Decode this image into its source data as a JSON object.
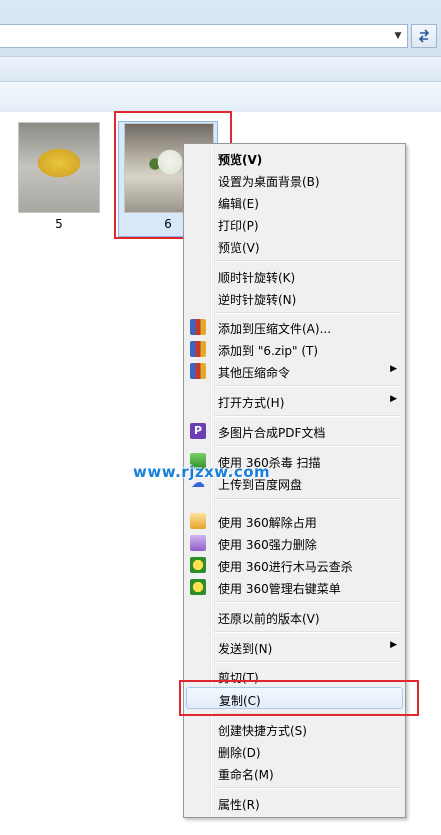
{
  "thumbnails": [
    {
      "name": "5"
    },
    {
      "name": "6"
    }
  ],
  "context_menu": {
    "items": [
      {
        "label": "预览(V)",
        "bold": true
      },
      {
        "label": "设置为桌面背景(B)"
      },
      {
        "label": "编辑(E)"
      },
      {
        "label": "打印(P)"
      },
      {
        "label": "预览(V)"
      },
      {
        "label": "顺时针旋转(K)"
      },
      {
        "label": "逆时针旋转(N)"
      },
      {
        "label": "添加到压缩文件(A)...",
        "icon": "winrar-icon"
      },
      {
        "label": "添加到 \"6.zip\" (T)",
        "icon": "winrar-icon"
      },
      {
        "label": "其他压缩命令",
        "icon": "winrar-icon",
        "submenu": true
      },
      {
        "label": "打开方式(H)",
        "submenu": true
      },
      {
        "label": "多图片合成PDF文档",
        "icon": "pdf-icon",
        "icon_text": "P"
      },
      {
        "label": "使用 360杀毒 扫描",
        "icon": "shield-icon"
      },
      {
        "label": "上传到百度网盘",
        "icon": "baidu-cloud-icon"
      },
      {
        "label": "使用 360解除占用",
        "icon": "unlock-icon"
      },
      {
        "label": "使用 360强力删除",
        "icon": "erase-icon"
      },
      {
        "label": "使用 360进行木马云查杀",
        "icon": "360-icon"
      },
      {
        "label": "使用 360管理右键菜单",
        "icon": "360-icon"
      },
      {
        "label": "还原以前的版本(V)"
      },
      {
        "label": "发送到(N)",
        "submenu": true
      },
      {
        "label": "剪切(T)"
      },
      {
        "label": "复制(C)",
        "highlighted": true
      },
      {
        "label": "创建快捷方式(S)"
      },
      {
        "label": "删除(D)"
      },
      {
        "label": "重命名(M)"
      },
      {
        "label": "属性(R)"
      }
    ]
  },
  "watermark": "www.rjzxw.com",
  "colors": {
    "highlight_box": "#e0272d",
    "menu_background": "#f0f0f0",
    "watermark": "#1a7fd8"
  }
}
